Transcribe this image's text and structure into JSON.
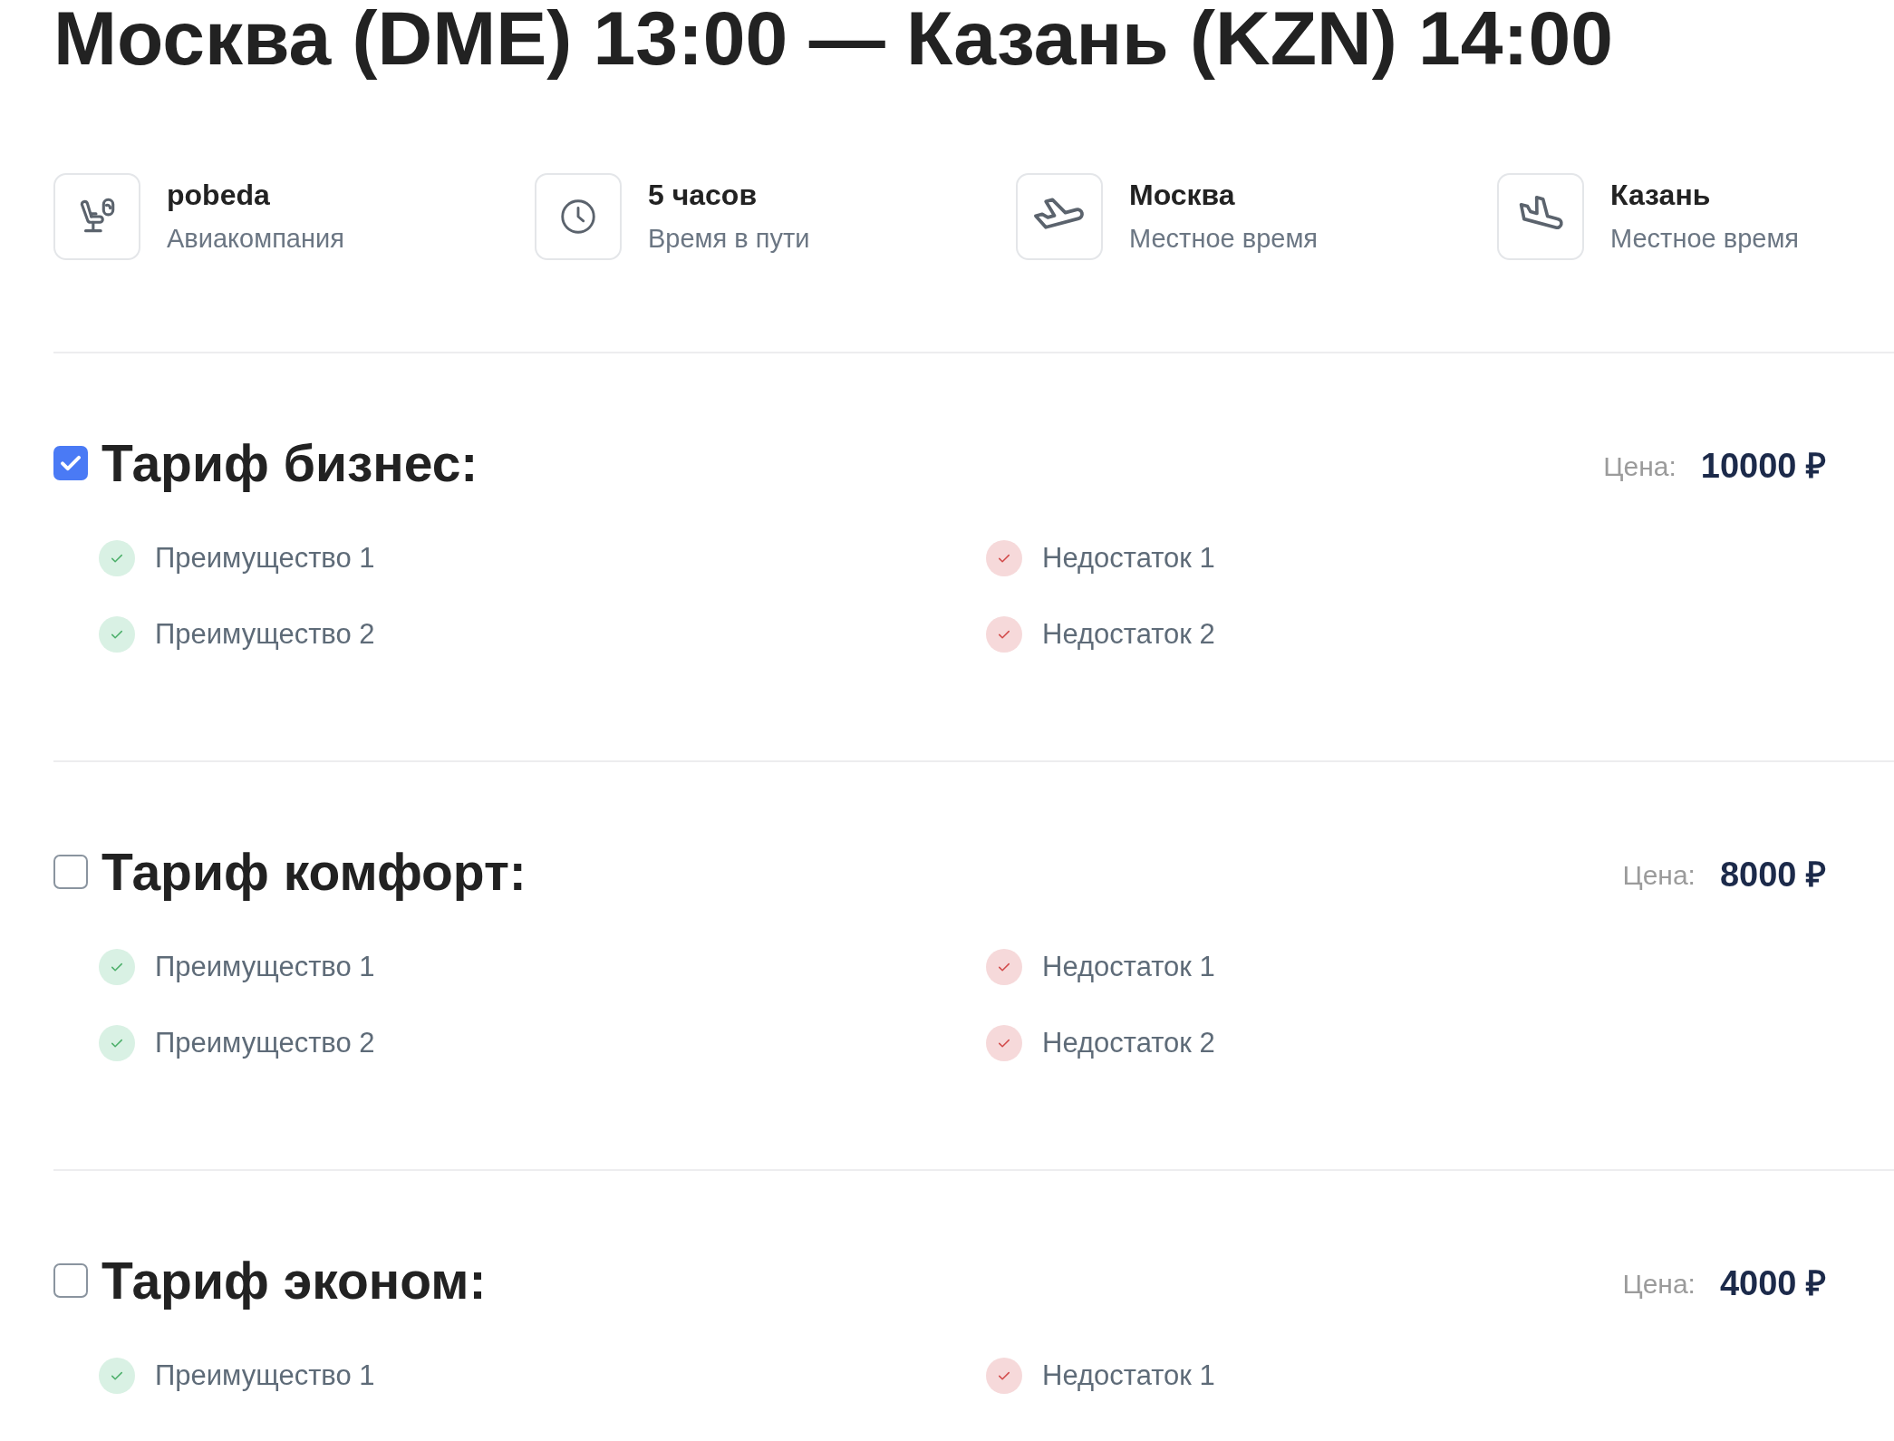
{
  "title": "Москва (DME) 13:00 — Казань (KZN) 14:00",
  "info": [
    {
      "kind": "airline",
      "value": "pobeda",
      "caption": "Авиакомпания"
    },
    {
      "kind": "duration",
      "value": "5 часов",
      "caption": "Время в пути"
    },
    {
      "kind": "departure",
      "value": "Москва",
      "caption": "Местное время"
    },
    {
      "kind": "arrival",
      "value": "Казань",
      "caption": "Местное время"
    }
  ],
  "tariffs": [
    {
      "name": "Тариф бизнес:",
      "checked": true,
      "price_label": "Цена:",
      "price": "10000 ₽",
      "pros": [
        "Преимущество 1",
        "Преимущество 2"
      ],
      "cons": [
        "Недостаток 1",
        "Недостаток 2"
      ]
    },
    {
      "name": "Тариф комфорт:",
      "checked": false,
      "price_label": "Цена:",
      "price": "8000 ₽",
      "pros": [
        "Преимущество 1",
        "Преимущество 2"
      ],
      "cons": [
        "Недостаток 1",
        "Недостаток 2"
      ]
    },
    {
      "name": "Тариф эконом:",
      "checked": false,
      "price_label": "Цена:",
      "price": "4000 ₽",
      "pros": [
        "Преимущество 1"
      ],
      "cons": [
        "Недостаток 1"
      ]
    }
  ]
}
